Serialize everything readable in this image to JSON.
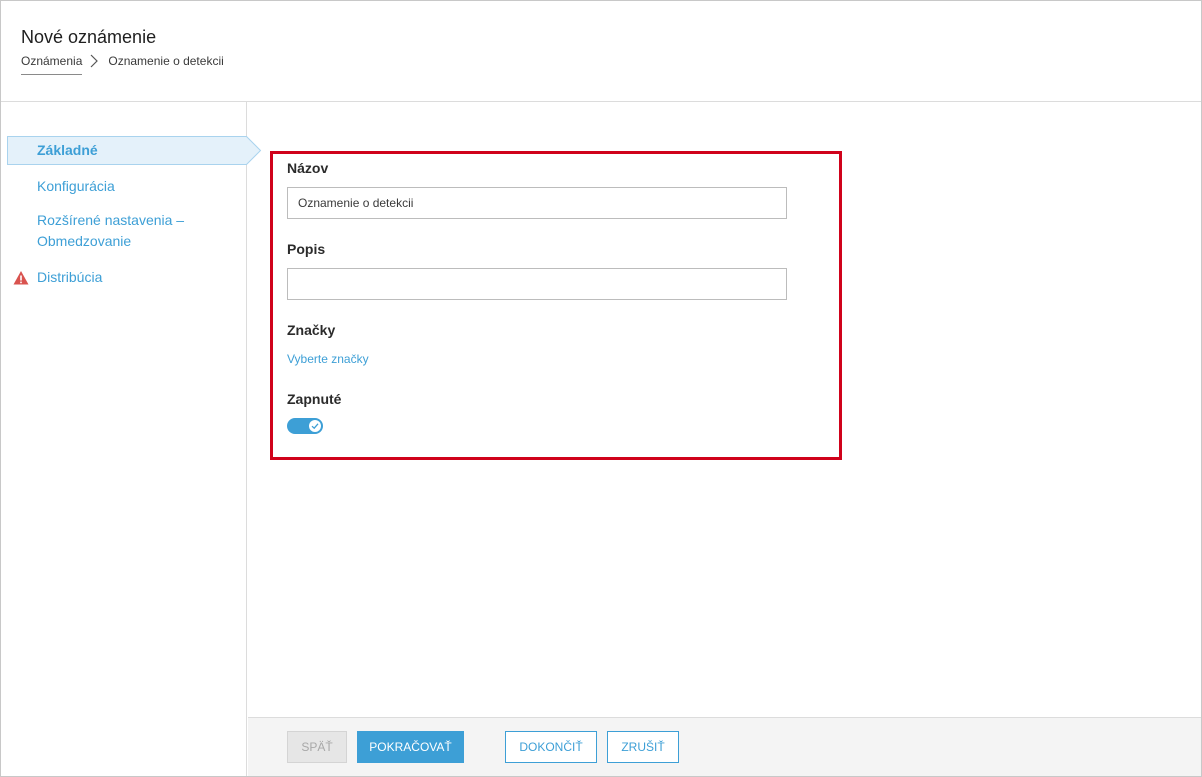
{
  "header": {
    "title": "Nové oznámenie",
    "breadcrumb": {
      "parent": "Oznámenia",
      "current": "Oznamenie o detekcii"
    }
  },
  "sidebar": {
    "items": [
      {
        "label": "Základné",
        "active": true
      },
      {
        "label": "Konfigurácia"
      },
      {
        "label": "Rozšírené nastavenia –",
        "label_line2": "Obmedzovanie"
      },
      {
        "label": "Distribúcia",
        "warning": true
      }
    ]
  },
  "form": {
    "name_label": "Názov",
    "name_value": "Oznamenie o detekcii",
    "description_label": "Popis",
    "description_value": "",
    "tags_label": "Značky",
    "tags_link": "Vyberte značky",
    "enabled_label": "Zapnuté",
    "enabled": true
  },
  "footer": {
    "back": "SPÄŤ",
    "continue": "POKRAČOVAŤ",
    "finish": "DOKONČIŤ",
    "cancel": "ZRUŠIŤ"
  },
  "colors": {
    "accent": "#3d9fd6",
    "highlight_border": "#d0021b",
    "warning": "#d9534f"
  }
}
